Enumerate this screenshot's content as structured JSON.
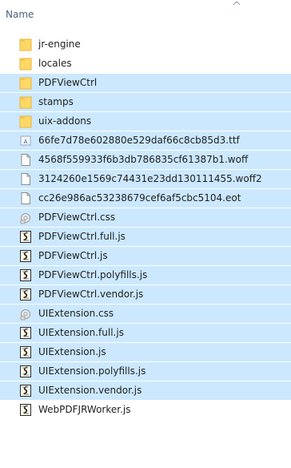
{
  "header": {
    "name_label": "Name"
  },
  "files": [
    {
      "name": "jr-engine",
      "icon": "folder-icon",
      "selected": false
    },
    {
      "name": "locales",
      "icon": "folder-icon",
      "selected": false
    },
    {
      "name": "PDFViewCtrl",
      "icon": "folder-icon",
      "selected": true
    },
    {
      "name": "stamps",
      "icon": "folder-icon",
      "selected": true
    },
    {
      "name": "uix-addons",
      "icon": "folder-icon",
      "selected": true
    },
    {
      "name": "66fe7d78e602880e529daf66c8cb85d3.ttf",
      "icon": "font-file-icon",
      "selected": true
    },
    {
      "name": "4568f559933f6b3db786835cf61387b1.woff",
      "icon": "blank-file-icon",
      "selected": true
    },
    {
      "name": "3124260e1569c74431e23dd130111455.woff2",
      "icon": "blank-file-icon",
      "selected": true
    },
    {
      "name": "cc26e986ac53238679cef6af5cbc5104.eot",
      "icon": "blank-file-icon",
      "selected": true
    },
    {
      "name": "PDFViewCtrl.css",
      "icon": "css-file-icon",
      "selected": true
    },
    {
      "name": "PDFViewCtrl.full.js",
      "icon": "script-file-icon",
      "selected": true
    },
    {
      "name": "PDFViewCtrl.js",
      "icon": "script-file-icon",
      "selected": true
    },
    {
      "name": "PDFViewCtrl.polyfills.js",
      "icon": "script-file-icon",
      "selected": true
    },
    {
      "name": "PDFViewCtrl.vendor.js",
      "icon": "script-file-icon",
      "selected": true
    },
    {
      "name": "UIExtension.css",
      "icon": "css-file-icon",
      "selected": true
    },
    {
      "name": "UIExtension.full.js",
      "icon": "script-file-icon",
      "selected": true
    },
    {
      "name": "UIExtension.js",
      "icon": "script-file-icon",
      "selected": true
    },
    {
      "name": "UIExtension.polyfills.js",
      "icon": "script-file-icon",
      "selected": true
    },
    {
      "name": "UIExtension.vendor.js",
      "icon": "script-file-icon",
      "selected": true
    },
    {
      "name": "WebPDFJRWorker.js",
      "icon": "script-file-icon",
      "selected": false
    }
  ],
  "colors": {
    "selection": "#cce8ff",
    "header_text": "#4c607a",
    "folder": "#ffd866"
  }
}
